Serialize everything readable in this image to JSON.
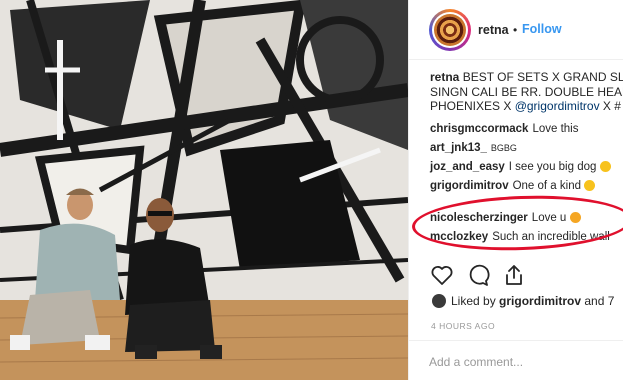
{
  "header": {
    "username": "retna",
    "separator": "•",
    "follow_label": "Follow"
  },
  "caption": {
    "username": "retna",
    "line1_rest": "BEST OF SETS X GRAND SLAI",
    "line2": "SINGN CALI BE RR. DOUBLE HEADE",
    "line3_start": "PHOENIXES X ",
    "line3_mention": "@grigordimitrov",
    "line3_end": " X #"
  },
  "comments": [
    {
      "username": "chrisgmccormack",
      "text": "Love this"
    },
    {
      "username": "art_jnk13_",
      "text": "BGBG"
    },
    {
      "username": "joz_and_easy",
      "text": "I see you big dog"
    },
    {
      "username": "grigordimitrov",
      "text": "One of a kind"
    },
    {
      "username": "nicolescherzinger",
      "text": "Love u"
    },
    {
      "username": "mcclozkey",
      "text": "Such an incredible wall"
    }
  ],
  "likes": {
    "prefix": "Liked by ",
    "user": "grigordimitrov",
    "suffix": " and 7"
  },
  "timestamp": "4 HOURS AGO",
  "add_comment": {
    "placeholder": "Add a comment..."
  },
  "colors": {
    "follow": "#3897f0",
    "highlight": "#e0102d",
    "muted": "#999999"
  },
  "icons": [
    "heart-icon",
    "comment-icon",
    "share-icon",
    "avatar-icon"
  ]
}
